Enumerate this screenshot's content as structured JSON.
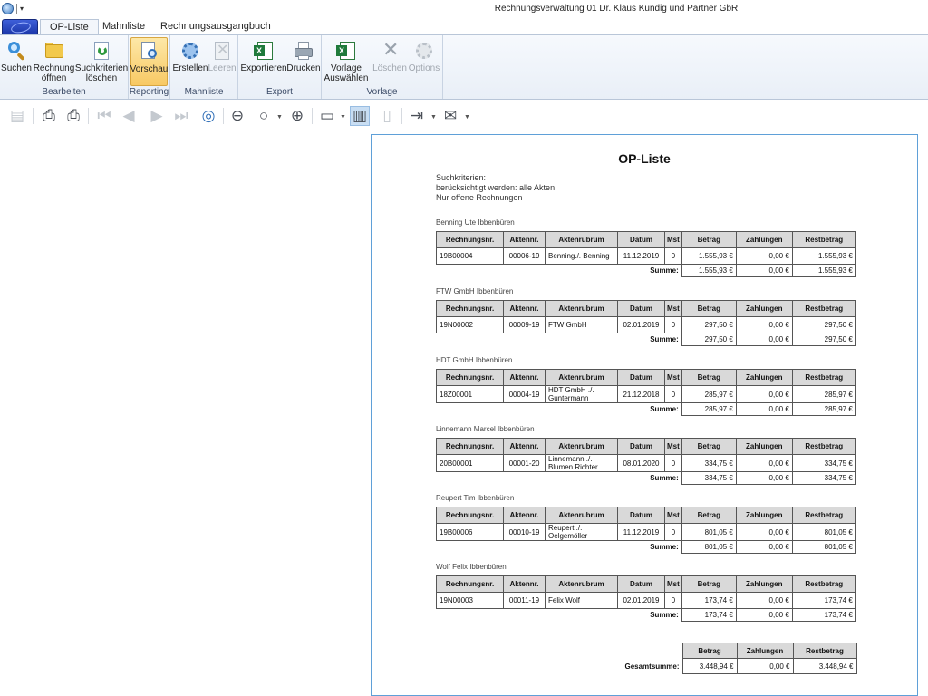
{
  "window": {
    "title": "Rechnungsverwaltung 01 Dr. Klaus Kundig und Partner GbR"
  },
  "tabs": [
    {
      "label": "OP-Liste"
    },
    {
      "label": "Mahnliste"
    },
    {
      "label": "Rechnungsausgangbuch"
    }
  ],
  "ribbon": {
    "groups": {
      "bearbeiten": "Bearbeiten",
      "reporting": "Reporting",
      "mahnliste": "Mahnliste",
      "export": "Export",
      "vorlage": "Vorlage"
    },
    "buttons": {
      "suchen": "Suchen",
      "rechnung_oeffnen_1": "Rechnung",
      "rechnung_oeffnen_2": "öffnen",
      "suchkriterien_1": "Suchkriterien",
      "suchkriterien_2": "löschen",
      "vorschau": "Vorschau",
      "erstellen": "Erstellen",
      "leeren": "Leeren",
      "exportieren": "Exportieren",
      "drucken": "Drucken",
      "vorlage_1": "Vorlage",
      "vorlage_2": "Auswählen",
      "loeschen": "Löschen",
      "options": "Options"
    }
  },
  "toolbar": {
    "icons": [
      "document-map-icon",
      "print-icon",
      "quick-print-icon",
      "first-page-icon",
      "previous-page-icon",
      "next-page-icon",
      "last-page-icon",
      "navigation-icon",
      "zoom-out-icon",
      "zoom-icon",
      "zoom-in-icon",
      "page-setup-icon",
      "multipage-icon",
      "single-page-icon",
      "export-icon",
      "email-icon"
    ]
  },
  "report": {
    "title": "OP-Liste",
    "criteria_label": "Suchkriterien:",
    "criteria_line1": "berücksichtigt werden: alle Akten",
    "criteria_line2": "Nur offene Rechnungen",
    "columns": [
      "Rechnungsnr.",
      "Aktennr.",
      "Aktenrubrum",
      "Datum",
      "Mst",
      "Betrag",
      "Zahlungen",
      "Restbetrag"
    ],
    "sum_label": "Summe:",
    "groups": [
      {
        "name": "Benning Ute Ibbenbüren",
        "row": {
          "rechnungsnr": "19B00004",
          "aktennr": "00006-19",
          "rubrum": "Benning./. Benning",
          "datum": "11.12.2019",
          "mst": "0",
          "betrag": "1.555,93 €",
          "zahlungen": "0,00 €",
          "rest": "1.555,93 €"
        },
        "sum": {
          "betrag": "1.555,93 €",
          "zahlungen": "0,00 €",
          "rest": "1.555,93 €"
        }
      },
      {
        "name": "FTW GmbH Ibbenbüren",
        "row": {
          "rechnungsnr": "19N00002",
          "aktennr": "00009-19",
          "rubrum": "FTW GmbH",
          "datum": "02.01.2019",
          "mst": "0",
          "betrag": "297,50 €",
          "zahlungen": "0,00 €",
          "rest": "297,50 €"
        },
        "sum": {
          "betrag": "297,50 €",
          "zahlungen": "0,00 €",
          "rest": "297,50 €"
        }
      },
      {
        "name": "HDT GmbH Ibbenbüren",
        "row": {
          "rechnungsnr": "18Z00001",
          "aktennr": "00004-19",
          "rubrum": "HDT GmbH ./. Guntermann",
          "datum": "21.12.2018",
          "mst": "0",
          "betrag": "285,97 €",
          "zahlungen": "0,00 €",
          "rest": "285,97 €"
        },
        "sum": {
          "betrag": "285,97 €",
          "zahlungen": "0,00 €",
          "rest": "285,97 €"
        }
      },
      {
        "name": "Linnemann Marcel Ibbenbüren",
        "row": {
          "rechnungsnr": "20B00001",
          "aktennr": "00001-20",
          "rubrum": "Linnemann ./. Blumen Richter",
          "datum": "08.01.2020",
          "mst": "0",
          "betrag": "334,75 €",
          "zahlungen": "0,00 €",
          "rest": "334,75 €"
        },
        "sum": {
          "betrag": "334,75 €",
          "zahlungen": "0,00 €",
          "rest": "334,75 €"
        }
      },
      {
        "name": "Reupert Tim Ibbenbüren",
        "row": {
          "rechnungsnr": "19B00006",
          "aktennr": "00010-19",
          "rubrum": "Reupert ./. Oelgemöller",
          "datum": "11.12.2019",
          "mst": "0",
          "betrag": "801,05 €",
          "zahlungen": "0,00 €",
          "rest": "801,05 €"
        },
        "sum": {
          "betrag": "801,05 €",
          "zahlungen": "0,00 €",
          "rest": "801,05 €"
        }
      },
      {
        "name": "Wolf Felix Ibbenbüren",
        "row": {
          "rechnungsnr": "19N00003",
          "aktennr": "00011-19",
          "rubrum": "Felix Wolf",
          "datum": "02.01.2019",
          "mst": "0",
          "betrag": "173,74 €",
          "zahlungen": "0,00 €",
          "rest": "173,74 €"
        },
        "sum": {
          "betrag": "173,74 €",
          "zahlungen": "0,00 €",
          "rest": "173,74 €"
        }
      }
    ],
    "total": {
      "label": "Gesamtsumme:",
      "columns": [
        "Betrag",
        "Zahlungen",
        "Restbetrag"
      ],
      "betrag": "3.448,94 €",
      "zahlungen": "0,00 €",
      "rest": "3.448,94 €"
    }
  }
}
